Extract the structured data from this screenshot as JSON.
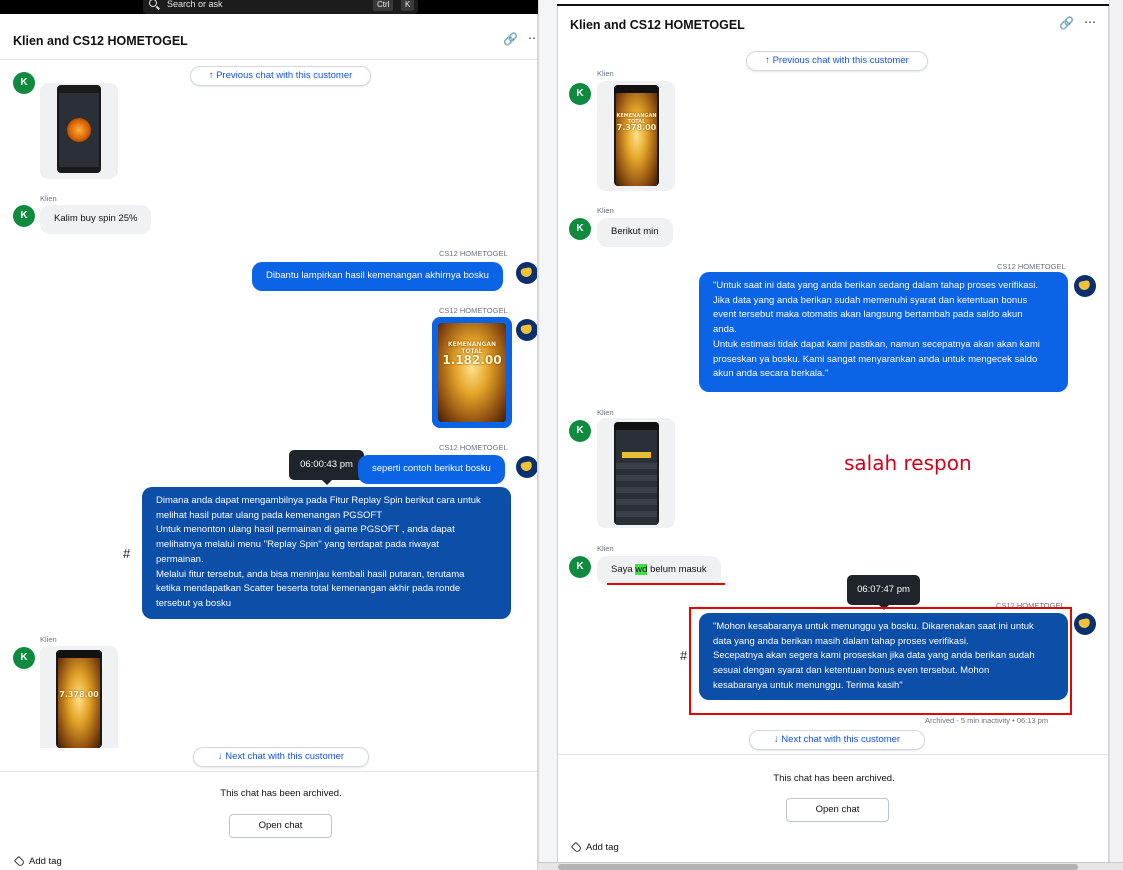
{
  "search": {
    "placeholder": "Search or ask",
    "key1": "Ctrl",
    "key2": "K"
  },
  "left": {
    "title": "Klien and CS12 HOMETOGEL",
    "prev_label": "Previous chat with this customer",
    "next_label": "Next chat with this customer",
    "client_name": "Klien",
    "agent_name": "CS12 HOMETOGEL",
    "avatar_letter": "K",
    "msg_client_1": "Kalim buy spin 25%",
    "msg_agent_1": "Dibantu lampirkan hasil kemenangan akhirnya bosku",
    "win_image_amount": "1.182.00",
    "win_image_label": "KEMENANGAN TOTAL",
    "tooltip": "06:00:43 pm",
    "msg_agent_2": "seperti contoh berikut bosku",
    "msg_agent_3_lines": [
      "Dimana anda dapat mengambilnya pada Fitur Replay Spin berikut cara untuk",
      "melihat hasil putar ulang pada kemenangan PGSOFT",
      "Untuk menonton ulang hasil permainan di game PGSOFT , anda dapat",
      "melihatnya melalui menu \"Replay Spin\" yang terdapat pada riwayat",
      "permainan.",
      "Melalui fitur tersebut, anda bisa meninjau kembali hasil putaran, terutama",
      "ketika mendapatkan Scatter beserta total kemenangan akhir pada ronde",
      "tersebut ya bosku"
    ],
    "hash": "#",
    "img3_amount": "7.378.00",
    "archived_note": "This chat has been archived.",
    "open_chat": "Open chat",
    "add_tag": "Add tag"
  },
  "right": {
    "title": "Klien and CS12 HOMETOGEL",
    "prev_label": "Previous chat with this customer",
    "next_label": "Next chat with this customer",
    "client_name": "Klien",
    "agent_name": "CS12 HOMETOGEL",
    "avatar_letter": "K",
    "img1_amount": "7.378.00",
    "img1_label": "KEMENANGAN TOTAL",
    "msg_client_1": "Berikut min",
    "msg_agent_1_lines": [
      "\"Untuk saat ini data yang anda berikan sedang dalam tahap proses verifikasi.",
      "Jika data yang anda berikan sudah memenuhi syarat dan ketentuan bonus",
      "event tersebut maka otomatis akan langsung bertambah pada saldo akun",
      "anda.",
      "Untuk estimasi tidak dapat kami pastikan, namun secepatnya akan akan kami",
      "proseskan ya bosku. Kami sangat menyarankan anda untuk mengecek saldo",
      "akun anda secara berkala.\""
    ],
    "annotation": "salah respon",
    "msg_client_2_pre": "Saya ",
    "msg_client_2_hl": "wd",
    "msg_client_2_post": " belum masuk",
    "tooltip": "06:07:47 pm",
    "hash": "#",
    "msg_agent_2_lines": [
      "\"Mohon kesabaranya untuk menunggu ya bosku. Dikarenakan saat ini untuk",
      "data yang anda berikan masih dalam tahap proses verifikasi.",
      "Secepatnya akan segera kami proseskan jika data yang anda berikan sudah",
      "sesuai dengan syarat dan ketentuan bonus even tersebut. Mohon",
      "kesabaranya untuk menunggu. Terima kasih\""
    ],
    "status_meta": "Archived - 5 min inactivity • 06:13 pm",
    "archived_note": "This chat has been archived.",
    "open_chat": "Open chat",
    "add_tag": "Add tag"
  }
}
